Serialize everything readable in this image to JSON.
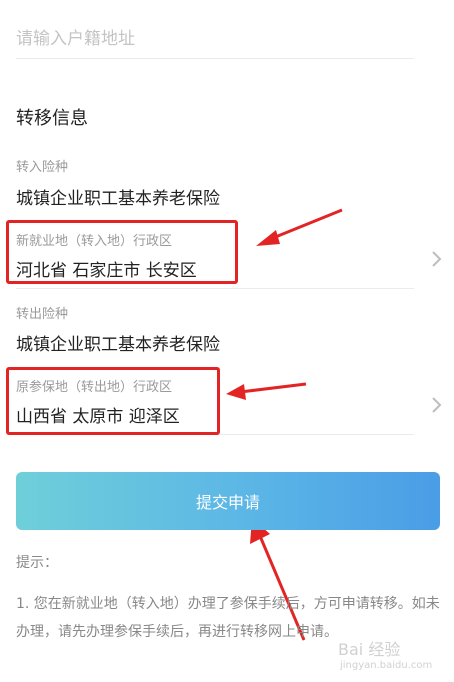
{
  "address": {
    "placeholder": "请输入户籍地址"
  },
  "section": {
    "title": "转移信息"
  },
  "transfer_in": {
    "insurance_label": "转入险种",
    "insurance_value": "城镇企业职工基本养老保险",
    "region_label": "新就业地（转入地）行政区",
    "region_value": "河北省 石家庄市 长安区"
  },
  "transfer_out": {
    "insurance_label": "转出险种",
    "insurance_value": "城镇企业职工基本养老保险",
    "region_label": "原参保地（转出地）行政区",
    "region_value": "山西省 太原市 迎泽区"
  },
  "submit_label": "提交申请",
  "hint": {
    "title": "提示：",
    "text": "1. 您在新就业地（转入地）办理了参保手续后，方可申请转移。如未办理，请先办理参保手续后，再进行转移网上申请。"
  },
  "watermark": {
    "main": "Bai 经验",
    "sub": "jingyan.baidu.com"
  },
  "colors": {
    "accent_gradient_start": "#6fcfd9",
    "accent_gradient_end": "#4a9de6",
    "annotation_red": "#e32424"
  }
}
